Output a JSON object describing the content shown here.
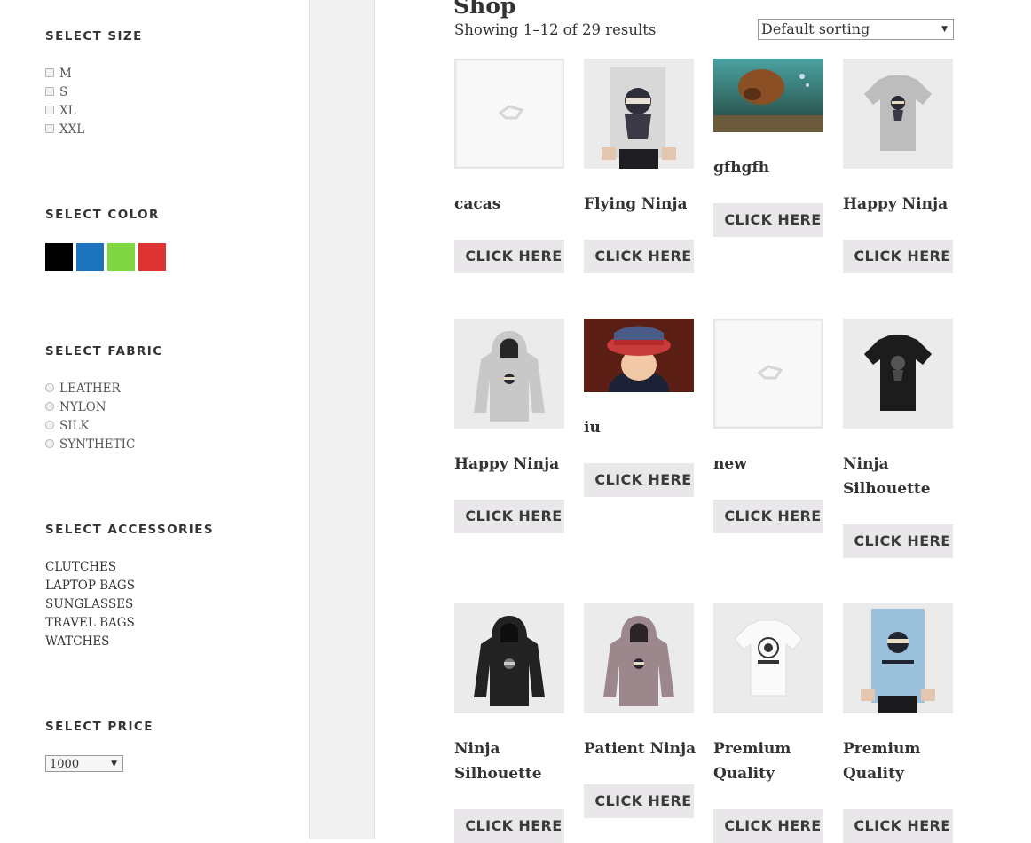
{
  "sidebar": {
    "size": {
      "title": "SELECT SIZE",
      "options": [
        "M",
        "S",
        "XL",
        "XXL"
      ]
    },
    "color": {
      "title": "SELECT COLOR",
      "swatches": [
        "#000000",
        "#1e73be",
        "#81d742",
        "#dd3333"
      ]
    },
    "fabric": {
      "title": "SELECT FABRIC",
      "options": [
        "LEATHER",
        "NYLON",
        "SILK",
        "SYNTHETIC"
      ]
    },
    "accessories": {
      "title": "SELECT ACCESSORIES",
      "options": [
        "CLUTCHES",
        "LAPTOP BAGS",
        "SUNGLASSES",
        "TRAVEL BAGS",
        "WATCHES"
      ]
    },
    "price": {
      "title": "SELECT PRICE",
      "selected": "1000"
    }
  },
  "main": {
    "title": "Shop",
    "result_count": "Showing 1–12 of 29 results",
    "sorting": "Default sorting",
    "button_label": "CLICK HERE",
    "products": [
      {
        "name": "cacas",
        "image": "placeholder"
      },
      {
        "name": "Flying Ninja",
        "image": "ninja-poster"
      },
      {
        "name": "gfhgfh",
        "image": "underwater-dog"
      },
      {
        "name": "Happy Ninja",
        "image": "grey-tshirt"
      },
      {
        "name": "Happy Ninja",
        "image": "grey-hoodie"
      },
      {
        "name": "iu",
        "image": "child-hat"
      },
      {
        "name": "new",
        "image": "placeholder"
      },
      {
        "name": "Ninja Silhouette",
        "image": "black-tshirt"
      },
      {
        "name": "Ninja Silhouette",
        "image": "black-hoodie"
      },
      {
        "name": "Patient Ninja",
        "image": "pink-hoodie"
      },
      {
        "name": "Premium Quality",
        "image": "white-tshirt"
      },
      {
        "name": "Premium Quality",
        "image": "blue-poster"
      }
    ]
  }
}
